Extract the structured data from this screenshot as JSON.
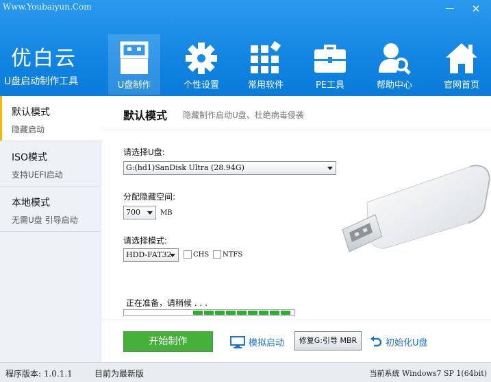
{
  "header": {
    "site_url": "Www.Youbaiyun.Com",
    "minimize_symbol": "—",
    "close_symbol": "✕",
    "brand_title": "优白云",
    "brand_subtitle": "U盘启动制作工具",
    "nav": [
      {
        "label": "U盘制作",
        "icon": "usb-drive-icon",
        "active": true
      },
      {
        "label": "个性设置",
        "icon": "gear-icon",
        "active": false
      },
      {
        "label": "常用软件",
        "icon": "grid-apps-icon",
        "active": false
      },
      {
        "label": "PE工具",
        "icon": "toolbox-icon",
        "active": false
      },
      {
        "label": "帮助中心",
        "icon": "user-search-icon",
        "active": false
      },
      {
        "label": "官网首页",
        "icon": "home-icon",
        "active": false
      }
    ]
  },
  "sidebar": {
    "items": [
      {
        "title": "默认模式",
        "subtitle": "隐藏启动",
        "active": true
      },
      {
        "title": "ISO模式",
        "subtitle": "支持UEFI启动",
        "active": false
      },
      {
        "title": "本地模式",
        "subtitle": "无需U盘 引导启动",
        "active": false
      }
    ]
  },
  "main": {
    "title": "默认模式",
    "description": "隐藏制作启动U盘、杜绝病毒侵袭",
    "select_usb_label": "请选择U盘:",
    "usb_value": "G:(hd1)SanDisk Ultra (28.94G)",
    "space_label": "分配隐藏空间:",
    "space_value": "700",
    "space_unit": "MB",
    "mode_label": "请选择模式:",
    "mode_value": "HDD-FAT32",
    "chs_label": "CHS",
    "ntfs_label": "NTFS",
    "status_text": "正在准备，请稍候 . . .",
    "start_button": "开始制作",
    "simulate_label": "模拟启动",
    "repair_mbr_label": "修复G:引导 MBR",
    "init_usb_label": "初始化U盘"
  },
  "statusbar": {
    "version": "程序版本: 1.0.1.1",
    "latest": "目前为最新版",
    "os": "当前系统 Windows7 SP 1(64bit)"
  },
  "colors": {
    "header_blue": "#0f82e0",
    "start_green": "#45b03a",
    "link_blue": "#1a73c9",
    "active_marker": "#ffb400"
  }
}
